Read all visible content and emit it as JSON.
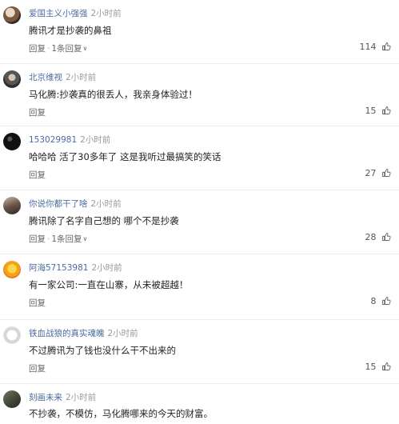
{
  "labels": {
    "reply": "回复",
    "sep": "·"
  },
  "comments": [
    {
      "username": "爱国主义小强强",
      "time": "2小时前",
      "text": "腾讯才是抄袭的鼻祖",
      "replies": "1条回复",
      "likes": "114"
    },
    {
      "username": "北京维视",
      "time": "2小时前",
      "text": "马化腾:抄袭真的很丢人，我亲身体验过！",
      "replies": "",
      "likes": "15"
    },
    {
      "username": "153029981",
      "time": "2小时前",
      "text": "哈哈哈 活了30多年了 这是我听过最搞笑的笑话",
      "replies": "",
      "likes": "27"
    },
    {
      "username": "你说你都干了啥",
      "time": "2小时前",
      "text": "腾讯除了名字自己想的 哪个不是抄袭",
      "replies": "1条回复",
      "likes": "28"
    },
    {
      "username": "阿海57153981",
      "time": "2小时前",
      "text": "有一家公司:一直在山寨，从未被超越！",
      "replies": "",
      "likes": "8"
    },
    {
      "username": "铁血战狼的真实魂魄",
      "time": "2小时前",
      "text": "不过腾讯为了钱也没什么干不出来的",
      "replies": "",
      "likes": "15"
    },
    {
      "username": "刻画未来",
      "time": "2小时前",
      "text": "不抄袭，不模仿，马化腾哪来的今天的财富。",
      "replies": "",
      "likes": ""
    }
  ]
}
